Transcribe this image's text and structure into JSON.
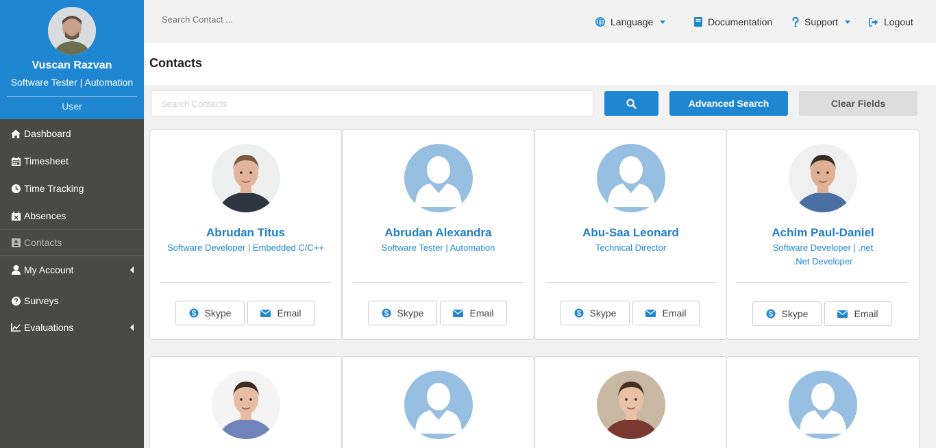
{
  "user": {
    "name": "Vuscan Razvan",
    "role": "Software Tester | Automation",
    "type": "User"
  },
  "sidebar": {
    "items": [
      {
        "label": "Dashboard",
        "icon": "home-icon"
      },
      {
        "label": "Timesheet",
        "icon": "calendar-icon"
      },
      {
        "label": "Time Tracking",
        "icon": "clock-icon"
      },
      {
        "label": "Absences",
        "icon": "calendar-x-icon"
      },
      {
        "label": "Contacts",
        "icon": "address-book-icon",
        "active": true
      },
      {
        "label": "My Account",
        "icon": "user-icon",
        "has_submenu": true
      },
      {
        "label": "Surveys",
        "icon": "question-circle-icon"
      },
      {
        "label": "Evaluations",
        "icon": "line-chart-icon",
        "has_submenu": true
      }
    ]
  },
  "topbar": {
    "search_placeholder": "Search Contact ...",
    "language": "Language",
    "documentation": "Documentation",
    "support": "Support",
    "logout": "Logout"
  },
  "page": {
    "title": "Contacts"
  },
  "search": {
    "placeholder": "Search Contacts",
    "advanced_label": "Advanced Search",
    "clear_label": "Clear Fields"
  },
  "contacts": [
    {
      "name": "Abrudan Titus",
      "title": "Software Developer | Embedded C/C++",
      "title2": "",
      "photo": "photo",
      "skype": "Skype",
      "email": "Email"
    },
    {
      "name": "Abrudan Alexandra",
      "title": "Software Tester | Automation",
      "title2": "",
      "photo": "placeholder",
      "skype": "Skype",
      "email": "Email"
    },
    {
      "name": "Abu-Saa Leonard",
      "title": "Technical Director",
      "title2": "",
      "photo": "placeholder",
      "skype": "Skype",
      "email": "Email"
    },
    {
      "name": "Achim Paul-Daniel",
      "title": "Software Developer | .net",
      "title2": ".Net Developer",
      "photo": "photo",
      "skype": "Skype",
      "email": "Email"
    },
    {
      "name": "",
      "title": "",
      "photo": "photo"
    },
    {
      "name": "",
      "title": "",
      "photo": "placeholder"
    },
    {
      "name": "",
      "title": "",
      "photo": "photo"
    },
    {
      "name": "",
      "title": "",
      "photo": "placeholder"
    }
  ],
  "colors": {
    "primary": "#1f86d2",
    "sidebar": "#4a4a45",
    "avatar_placeholder": "#97bfe2"
  }
}
